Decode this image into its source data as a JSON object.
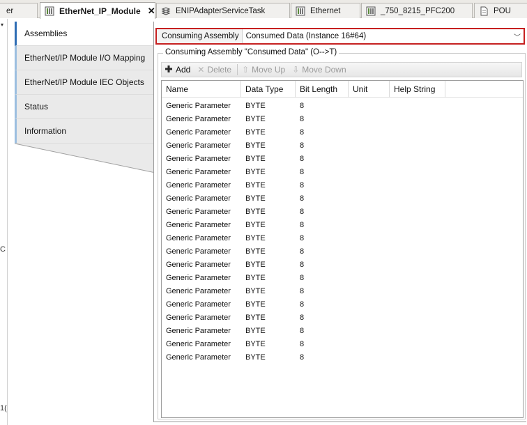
{
  "tabs": [
    {
      "label": "er",
      "icon": "device-icon",
      "active": false
    },
    {
      "label": "EtherNet_IP_Module",
      "icon": "device-icon",
      "active": true,
      "close": "✕"
    },
    {
      "label": "ENIPAdapterServiceTask",
      "icon": "task-icon",
      "active": false
    },
    {
      "label": "Ethernet",
      "icon": "device-icon",
      "active": false
    },
    {
      "label": "_750_8215_PFC200",
      "icon": "device-icon",
      "active": false
    },
    {
      "label": "POU",
      "icon": "document-icon",
      "active": false
    }
  ],
  "gutter": {
    "arrow": "▾",
    "glyph_a": "C",
    "glyph_b": "1("
  },
  "nav": {
    "items": [
      {
        "label": "Assemblies",
        "active": true
      },
      {
        "label": "EtherNet/IP Module I/O Mapping",
        "active": false
      },
      {
        "label": "EtherNet/IP Module IEC Objects",
        "active": false
      },
      {
        "label": "Status",
        "active": false
      },
      {
        "label": "Information",
        "active": false
      }
    ]
  },
  "assembly_selector": {
    "label": "Consuming Assembly",
    "value": "Consumed Data (Instance 16#64)"
  },
  "group": {
    "title": "Consuming Assembly \"Consumed Data\" (O-->T)"
  },
  "toolbar": {
    "add": "Add",
    "delete": "Delete",
    "move_up": "Move Up",
    "move_down": "Move Down"
  },
  "table": {
    "columns": [
      "Name",
      "Data Type",
      "Bit Length",
      "Unit",
      "Help String"
    ],
    "rows": [
      [
        "Generic Parameter",
        "BYTE",
        "8",
        "",
        ""
      ],
      [
        "Generic Parameter",
        "BYTE",
        "8",
        "",
        ""
      ],
      [
        "Generic Parameter",
        "BYTE",
        "8",
        "",
        ""
      ],
      [
        "Generic Parameter",
        "BYTE",
        "8",
        "",
        ""
      ],
      [
        "Generic Parameter",
        "BYTE",
        "8",
        "",
        ""
      ],
      [
        "Generic Parameter",
        "BYTE",
        "8",
        "",
        ""
      ],
      [
        "Generic Parameter",
        "BYTE",
        "8",
        "",
        ""
      ],
      [
        "Generic Parameter",
        "BYTE",
        "8",
        "",
        ""
      ],
      [
        "Generic Parameter",
        "BYTE",
        "8",
        "",
        ""
      ],
      [
        "Generic Parameter",
        "BYTE",
        "8",
        "",
        ""
      ],
      [
        "Generic Parameter",
        "BYTE",
        "8",
        "",
        ""
      ],
      [
        "Generic Parameter",
        "BYTE",
        "8",
        "",
        ""
      ],
      [
        "Generic Parameter",
        "BYTE",
        "8",
        "",
        ""
      ],
      [
        "Generic Parameter",
        "BYTE",
        "8",
        "",
        ""
      ],
      [
        "Generic Parameter",
        "BYTE",
        "8",
        "",
        ""
      ],
      [
        "Generic Parameter",
        "BYTE",
        "8",
        "",
        ""
      ],
      [
        "Generic Parameter",
        "BYTE",
        "8",
        "",
        ""
      ],
      [
        "Generic Parameter",
        "BYTE",
        "8",
        "",
        ""
      ],
      [
        "Generic Parameter",
        "BYTE",
        "8",
        "",
        ""
      ],
      [
        "Generic Parameter",
        "BYTE",
        "8",
        "",
        ""
      ]
    ]
  },
  "colors": {
    "selector_border": "#c62020",
    "nav_active_accent": "#2e6db4"
  }
}
